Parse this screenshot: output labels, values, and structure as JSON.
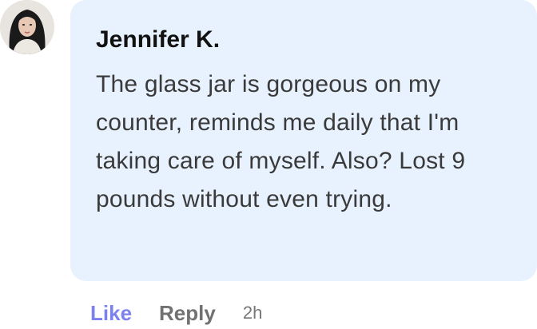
{
  "comment": {
    "author": "Jennifer K.",
    "text": "The glass jar is gorgeous on my counter, reminds me daily that I'm taking care of myself. Also? Lost 9 pounds without even trying.",
    "avatar_icon": "user-avatar-photo",
    "bubble_color": "#e8f2fe",
    "actions": {
      "like_label": "Like",
      "reply_label": "Reply",
      "timestamp": "2h",
      "like_color": "#7b82ee"
    }
  }
}
